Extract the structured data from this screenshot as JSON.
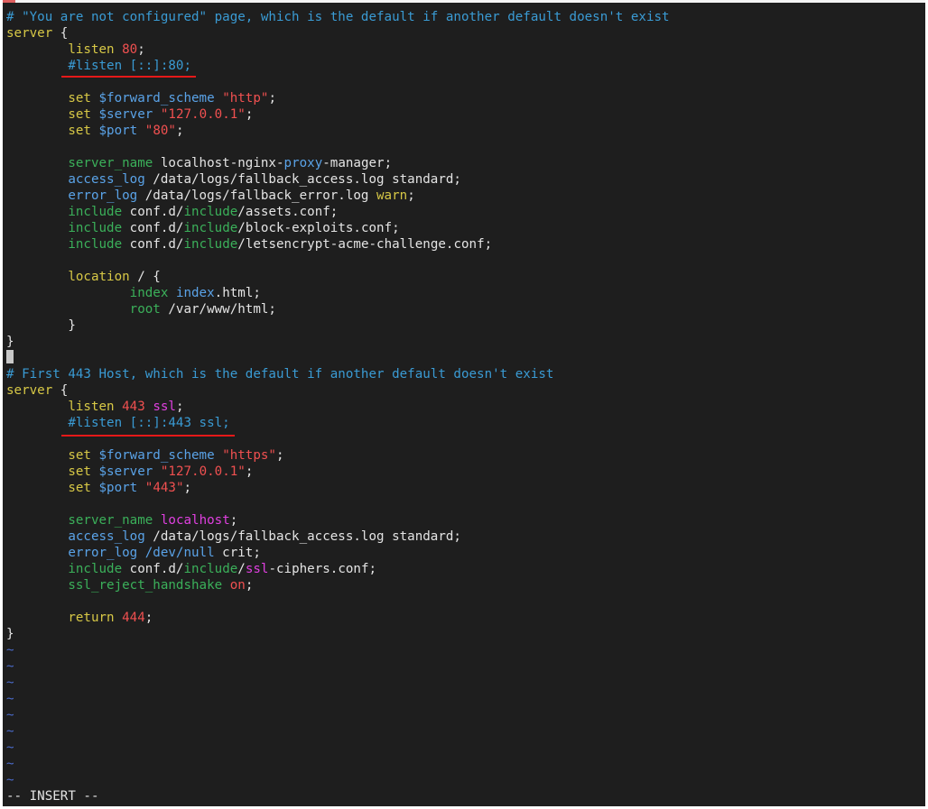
{
  "colors": {
    "background": "#1e1e1e",
    "default": "#e4e4e4",
    "comment": "#3a9bd4",
    "keyword": "#d7c846",
    "include": "#3bb05a",
    "number": "#f05050",
    "string": "#f05050",
    "variable": "#5aa3e8",
    "magenta": "#e040e0",
    "tilde": "#4a6ac8",
    "annotation": "#e61919"
  },
  "editor": {
    "lines": [
      [
        {
          "t": "# \"You are not configured\" page, which is the default if another default doesn't exist",
          "c": "comment"
        }
      ],
      [
        {
          "t": "server",
          "c": "keyword"
        },
        {
          "t": " {",
          "c": "default"
        }
      ],
      [
        {
          "t": "        ",
          "c": "default"
        },
        {
          "t": "listen",
          "c": "keyword"
        },
        {
          "t": " ",
          "c": "default"
        },
        {
          "t": "80",
          "c": "number"
        },
        {
          "t": ";",
          "c": "default"
        }
      ],
      [
        {
          "t": "        ",
          "c": "default"
        },
        {
          "t": "#listen [::]:80;",
          "c": "comment"
        }
      ],
      [
        {
          "t": "",
          "c": "default"
        }
      ],
      [
        {
          "t": "        ",
          "c": "default"
        },
        {
          "t": "set",
          "c": "keyword"
        },
        {
          "t": " ",
          "c": "default"
        },
        {
          "t": "$forward_scheme",
          "c": "variable"
        },
        {
          "t": " ",
          "c": "default"
        },
        {
          "t": "\"http\"",
          "c": "string"
        },
        {
          "t": ";",
          "c": "default"
        }
      ],
      [
        {
          "t": "        ",
          "c": "default"
        },
        {
          "t": "set",
          "c": "keyword"
        },
        {
          "t": " ",
          "c": "default"
        },
        {
          "t": "$server",
          "c": "variable"
        },
        {
          "t": " ",
          "c": "default"
        },
        {
          "t": "\"127.0.0.1\"",
          "c": "string"
        },
        {
          "t": ";",
          "c": "default"
        }
      ],
      [
        {
          "t": "        ",
          "c": "default"
        },
        {
          "t": "set",
          "c": "keyword"
        },
        {
          "t": " ",
          "c": "default"
        },
        {
          "t": "$port",
          "c": "variable"
        },
        {
          "t": " ",
          "c": "default"
        },
        {
          "t": "\"80\"",
          "c": "string"
        },
        {
          "t": ";",
          "c": "default"
        }
      ],
      [
        {
          "t": "",
          "c": "default"
        }
      ],
      [
        {
          "t": "        ",
          "c": "default"
        },
        {
          "t": "server_name",
          "c": "include"
        },
        {
          "t": " localhost-nginx-",
          "c": "default"
        },
        {
          "t": "proxy",
          "c": "variable"
        },
        {
          "t": "-manager;",
          "c": "default"
        }
      ],
      [
        {
          "t": "        ",
          "c": "default"
        },
        {
          "t": "access_log",
          "c": "variable"
        },
        {
          "t": " /data/logs/fallback_access.log standard;",
          "c": "default"
        }
      ],
      [
        {
          "t": "        ",
          "c": "default"
        },
        {
          "t": "error_log",
          "c": "variable"
        },
        {
          "t": " /data/logs/fallback_error.log ",
          "c": "default"
        },
        {
          "t": "warn",
          "c": "keyword"
        },
        {
          "t": ";",
          "c": "default"
        }
      ],
      [
        {
          "t": "        ",
          "c": "default"
        },
        {
          "t": "include",
          "c": "include"
        },
        {
          "t": " conf.d/",
          "c": "default"
        },
        {
          "t": "include",
          "c": "include"
        },
        {
          "t": "/assets.conf;",
          "c": "default"
        }
      ],
      [
        {
          "t": "        ",
          "c": "default"
        },
        {
          "t": "include",
          "c": "include"
        },
        {
          "t": " conf.d/",
          "c": "default"
        },
        {
          "t": "include",
          "c": "include"
        },
        {
          "t": "/block-exploits.conf;",
          "c": "default"
        }
      ],
      [
        {
          "t": "        ",
          "c": "default"
        },
        {
          "t": "include",
          "c": "include"
        },
        {
          "t": " conf.d/",
          "c": "default"
        },
        {
          "t": "include",
          "c": "include"
        },
        {
          "t": "/letsencrypt-acme-challenge.conf;",
          "c": "default"
        }
      ],
      [
        {
          "t": "",
          "c": "default"
        }
      ],
      [
        {
          "t": "        ",
          "c": "default"
        },
        {
          "t": "location",
          "c": "keyword"
        },
        {
          "t": " / {",
          "c": "default"
        }
      ],
      [
        {
          "t": "                ",
          "c": "default"
        },
        {
          "t": "index",
          "c": "include"
        },
        {
          "t": " ",
          "c": "default"
        },
        {
          "t": "index",
          "c": "variable"
        },
        {
          "t": ".html;",
          "c": "default"
        }
      ],
      [
        {
          "t": "                ",
          "c": "default"
        },
        {
          "t": "root",
          "c": "include"
        },
        {
          "t": " /var/www/html;",
          "c": "default"
        }
      ],
      [
        {
          "t": "        }",
          "c": "default"
        }
      ],
      [
        {
          "t": "}",
          "c": "default"
        }
      ],
      [
        {
          "t": "",
          "c": "cursor"
        }
      ],
      [
        {
          "t": "# First 443 Host, which is the default if another default doesn't exist",
          "c": "comment"
        }
      ],
      [
        {
          "t": "server",
          "c": "keyword"
        },
        {
          "t": " {",
          "c": "default"
        }
      ],
      [
        {
          "t": "        ",
          "c": "default"
        },
        {
          "t": "listen",
          "c": "keyword"
        },
        {
          "t": " ",
          "c": "default"
        },
        {
          "t": "443",
          "c": "number"
        },
        {
          "t": " ",
          "c": "default"
        },
        {
          "t": "ssl",
          "c": "magenta"
        },
        {
          "t": ";",
          "c": "default"
        }
      ],
      [
        {
          "t": "        ",
          "c": "default"
        },
        {
          "t": "#listen [::]:443 ssl;",
          "c": "comment"
        }
      ],
      [
        {
          "t": "",
          "c": "default"
        }
      ],
      [
        {
          "t": "        ",
          "c": "default"
        },
        {
          "t": "set",
          "c": "keyword"
        },
        {
          "t": " ",
          "c": "default"
        },
        {
          "t": "$forward_scheme",
          "c": "variable"
        },
        {
          "t": " ",
          "c": "default"
        },
        {
          "t": "\"https\"",
          "c": "string"
        },
        {
          "t": ";",
          "c": "default"
        }
      ],
      [
        {
          "t": "        ",
          "c": "default"
        },
        {
          "t": "set",
          "c": "keyword"
        },
        {
          "t": " ",
          "c": "default"
        },
        {
          "t": "$server",
          "c": "variable"
        },
        {
          "t": " ",
          "c": "default"
        },
        {
          "t": "\"127.0.0.1\"",
          "c": "string"
        },
        {
          "t": ";",
          "c": "default"
        }
      ],
      [
        {
          "t": "        ",
          "c": "default"
        },
        {
          "t": "set",
          "c": "keyword"
        },
        {
          "t": " ",
          "c": "default"
        },
        {
          "t": "$port",
          "c": "variable"
        },
        {
          "t": " ",
          "c": "default"
        },
        {
          "t": "\"443\"",
          "c": "string"
        },
        {
          "t": ";",
          "c": "default"
        }
      ],
      [
        {
          "t": "",
          "c": "default"
        }
      ],
      [
        {
          "t": "        ",
          "c": "default"
        },
        {
          "t": "server_name",
          "c": "include"
        },
        {
          "t": " ",
          "c": "default"
        },
        {
          "t": "localhost",
          "c": "magenta"
        },
        {
          "t": ";",
          "c": "default"
        }
      ],
      [
        {
          "t": "        ",
          "c": "default"
        },
        {
          "t": "access_log",
          "c": "variable"
        },
        {
          "t": " /data/logs/fallback_access.log standard;",
          "c": "default"
        }
      ],
      [
        {
          "t": "        ",
          "c": "default"
        },
        {
          "t": "error_log",
          "c": "variable"
        },
        {
          "t": " ",
          "c": "default"
        },
        {
          "t": "/dev/null",
          "c": "variable"
        },
        {
          "t": " crit;",
          "c": "default"
        }
      ],
      [
        {
          "t": "        ",
          "c": "default"
        },
        {
          "t": "include",
          "c": "include"
        },
        {
          "t": " conf.d/",
          "c": "default"
        },
        {
          "t": "include",
          "c": "include"
        },
        {
          "t": "/",
          "c": "default"
        },
        {
          "t": "ssl",
          "c": "magenta"
        },
        {
          "t": "-ciphers.conf;",
          "c": "default"
        }
      ],
      [
        {
          "t": "        ",
          "c": "default"
        },
        {
          "t": "ssl_reject_handshake",
          "c": "include"
        },
        {
          "t": " ",
          "c": "default"
        },
        {
          "t": "on",
          "c": "number"
        },
        {
          "t": ";",
          "c": "default"
        }
      ],
      [
        {
          "t": "",
          "c": "default"
        }
      ],
      [
        {
          "t": "        ",
          "c": "default"
        },
        {
          "t": "return",
          "c": "keyword"
        },
        {
          "t": " ",
          "c": "default"
        },
        {
          "t": "444",
          "c": "number"
        },
        {
          "t": ";",
          "c": "default"
        }
      ],
      [
        {
          "t": "}",
          "c": "default"
        }
      ],
      [
        {
          "t": "~",
          "c": "tilde"
        }
      ],
      [
        {
          "t": "~",
          "c": "tilde"
        }
      ],
      [
        {
          "t": "~",
          "c": "tilde"
        }
      ],
      [
        {
          "t": "~",
          "c": "tilde"
        }
      ],
      [
        {
          "t": "~",
          "c": "tilde"
        }
      ],
      [
        {
          "t": "~",
          "c": "tilde"
        }
      ],
      [
        {
          "t": "~",
          "c": "tilde"
        }
      ],
      [
        {
          "t": "~",
          "c": "tilde"
        }
      ],
      [
        {
          "t": "~",
          "c": "tilde"
        }
      ]
    ],
    "mode": "-- INSERT --"
  }
}
